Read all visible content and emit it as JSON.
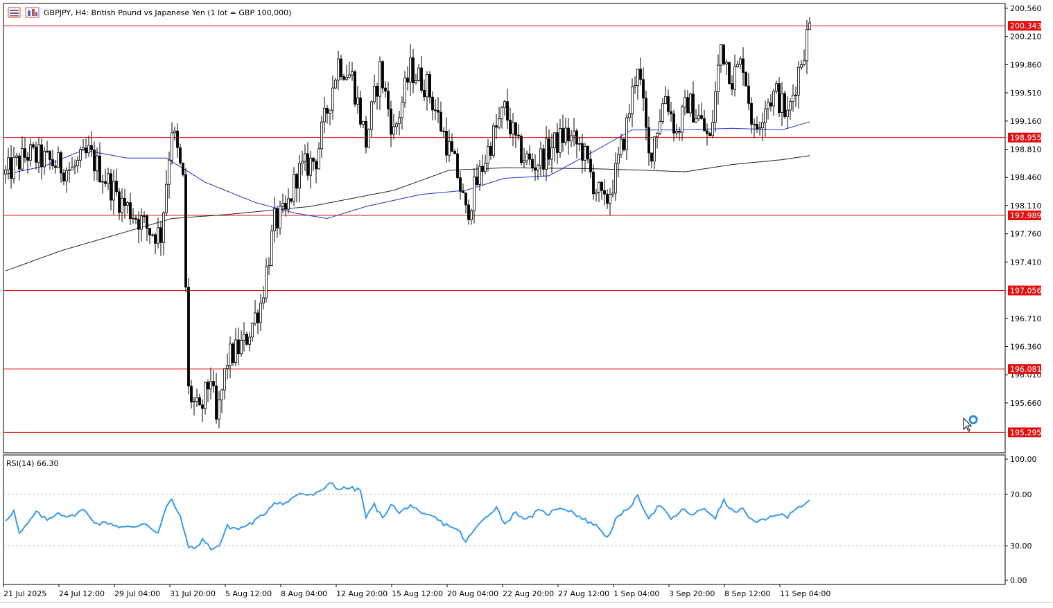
{
  "header": {
    "title": "GBPJPY, H4:  British Pound vs Japanese Yen (1 lot = GBP 100,000)"
  },
  "icons": {
    "menu": "chart-menu-icon",
    "ohlc": "chart-type-icon",
    "cursor": "arrow-cursor-icon",
    "loading": "loading-ring-icon"
  },
  "colors": {
    "candle": "#000000",
    "ma_fast": "#1f2fd6",
    "ma_slow": "#222222",
    "level_line": "#e01010",
    "rsi_line": "#3399ee",
    "axis": "#000000"
  },
  "chart_data": [
    {
      "type": "candlestick",
      "symbol": "GBPJPY",
      "timeframe": "H4",
      "ylim": [
        195.04,
        200.62
      ],
      "y_ticks": [
        "200.560",
        "200.210",
        "199.860",
        "199.510",
        "199.160",
        "198.810",
        "198.460",
        "198.110",
        "197.760",
        "197.410",
        "196.710",
        "196.360",
        "196.010",
        "195.660"
      ],
      "x_ticks": [
        "21 Jul 2025",
        "24 Jul 12:00",
        "29 Jul 04:00",
        "31 Jul 20:00",
        "5 Aug 12:00",
        "8 Aug 04:00",
        "12 Aug 20:00",
        "15 Aug 12:00",
        "20 Aug 04:00",
        "22 Aug 20:00",
        "27 Aug 12:00",
        "1 Sep 04:00",
        "3 Sep 20:00",
        "8 Sep 12:00",
        "11 Sep 04:00"
      ],
      "levels": [
        "200.343",
        "198.955",
        "197.989",
        "197.056",
        "196.081",
        "195.295"
      ],
      "anchors": [
        {
          "i": 0,
          "v": 198.5
        },
        {
          "i": 8,
          "v": 198.75
        },
        {
          "i": 16,
          "v": 198.65
        },
        {
          "i": 24,
          "v": 198.55
        },
        {
          "i": 30,
          "v": 198.75
        },
        {
          "i": 36,
          "v": 198.45
        },
        {
          "i": 42,
          "v": 198.15
        },
        {
          "i": 48,
          "v": 197.95
        },
        {
          "i": 52,
          "v": 197.8
        },
        {
          "i": 56,
          "v": 197.75
        },
        {
          "i": 60,
          "v": 199.1
        },
        {
          "i": 64,
          "v": 198.4
        },
        {
          "i": 66,
          "v": 195.8
        },
        {
          "i": 70,
          "v": 195.5
        },
        {
          "i": 74,
          "v": 196.0
        },
        {
          "i": 76,
          "v": 195.4
        },
        {
          "i": 80,
          "v": 196.2
        },
        {
          "i": 86,
          "v": 196.4
        },
        {
          "i": 92,
          "v": 196.9
        },
        {
          "i": 97,
          "v": 197.9
        },
        {
          "i": 101,
          "v": 198.0
        },
        {
          "i": 105,
          "v": 198.5
        },
        {
          "i": 112,
          "v": 198.7
        },
        {
          "i": 116,
          "v": 199.3
        },
        {
          "i": 120,
          "v": 199.9
        },
        {
          "i": 125,
          "v": 199.7
        },
        {
          "i": 130,
          "v": 198.9
        },
        {
          "i": 135,
          "v": 199.8
        },
        {
          "i": 140,
          "v": 199.0
        },
        {
          "i": 146,
          "v": 199.8
        },
        {
          "i": 152,
          "v": 199.6
        },
        {
          "i": 158,
          "v": 199.0
        },
        {
          "i": 163,
          "v": 198.5
        },
        {
          "i": 166,
          "v": 198.0
        },
        {
          "i": 170,
          "v": 198.4
        },
        {
          "i": 175,
          "v": 198.9
        },
        {
          "i": 180,
          "v": 199.3
        },
        {
          "i": 185,
          "v": 198.8
        },
        {
          "i": 190,
          "v": 198.6
        },
        {
          "i": 196,
          "v": 198.8
        },
        {
          "i": 202,
          "v": 199.0
        },
        {
          "i": 208,
          "v": 198.8
        },
        {
          "i": 212,
          "v": 198.4
        },
        {
          "i": 216,
          "v": 198.1
        },
        {
          "i": 220,
          "v": 198.5
        },
        {
          "i": 224,
          "v": 199.1
        },
        {
          "i": 228,
          "v": 199.9
        },
        {
          "i": 232,
          "v": 198.7
        },
        {
          "i": 238,
          "v": 199.5
        },
        {
          "i": 242,
          "v": 199.0
        },
        {
          "i": 246,
          "v": 199.4
        },
        {
          "i": 250,
          "v": 199.2
        },
        {
          "i": 254,
          "v": 198.9
        },
        {
          "i": 258,
          "v": 200.1
        },
        {
          "i": 262,
          "v": 199.7
        },
        {
          "i": 266,
          "v": 199.9
        },
        {
          "i": 270,
          "v": 199.0
        },
        {
          "i": 274,
          "v": 199.4
        },
        {
          "i": 278,
          "v": 199.5
        },
        {
          "i": 282,
          "v": 199.2
        },
        {
          "i": 286,
          "v": 199.8
        },
        {
          "i": 290,
          "v": 200.34
        }
      ],
      "series": [
        {
          "kind": "moving-average",
          "points": [
            {
              "i": 0,
              "v": 198.5
            },
            {
              "i": 14,
              "v": 198.6
            },
            {
              "i": 28,
              "v": 198.8
            },
            {
              "i": 44,
              "v": 198.7
            },
            {
              "i": 58,
              "v": 198.7
            },
            {
              "i": 72,
              "v": 198.4
            },
            {
              "i": 90,
              "v": 198.15
            },
            {
              "i": 104,
              "v": 198.02
            },
            {
              "i": 116,
              "v": 197.95
            },
            {
              "i": 130,
              "v": 198.1
            },
            {
              "i": 150,
              "v": 198.25
            },
            {
              "i": 166,
              "v": 198.3
            },
            {
              "i": 180,
              "v": 198.45
            },
            {
              "i": 196,
              "v": 198.48
            },
            {
              "i": 212,
              "v": 198.78
            },
            {
              "i": 226,
              "v": 199.05
            },
            {
              "i": 244,
              "v": 199.05
            },
            {
              "i": 262,
              "v": 199.07
            },
            {
              "i": 280,
              "v": 199.05
            },
            {
              "i": 290,
              "v": 199.15
            }
          ]
        },
        {
          "kind": "moving-average",
          "points": [
            {
              "i": 0,
              "v": 197.3
            },
            {
              "i": 20,
              "v": 197.55
            },
            {
              "i": 40,
              "v": 197.75
            },
            {
              "i": 60,
              "v": 197.95
            },
            {
              "i": 80,
              "v": 198.0
            },
            {
              "i": 110,
              "v": 198.1
            },
            {
              "i": 140,
              "v": 198.3
            },
            {
              "i": 160,
              "v": 198.55
            },
            {
              "i": 180,
              "v": 198.58
            },
            {
              "i": 210,
              "v": 198.57
            },
            {
              "i": 230,
              "v": 198.55
            },
            {
              "i": 245,
              "v": 198.53
            },
            {
              "i": 262,
              "v": 198.62
            },
            {
              "i": 280,
              "v": 198.68
            },
            {
              "i": 290,
              "v": 198.73
            }
          ]
        }
      ]
    },
    {
      "type": "line",
      "title": "RSI(14) 66.30",
      "ylim": [
        0,
        100
      ],
      "y_ticks": [
        "100.00",
        "70.00",
        "30.00",
        "0.00"
      ],
      "levels": [
        70,
        30
      ],
      "points": [
        {
          "i": 0,
          "v": 50
        },
        {
          "i": 3,
          "v": 57
        },
        {
          "i": 5,
          "v": 39
        },
        {
          "i": 8,
          "v": 47
        },
        {
          "i": 11,
          "v": 56
        },
        {
          "i": 15,
          "v": 50
        },
        {
          "i": 19,
          "v": 56
        },
        {
          "i": 23,
          "v": 52
        },
        {
          "i": 28,
          "v": 58
        },
        {
          "i": 33,
          "v": 47
        },
        {
          "i": 37,
          "v": 48
        },
        {
          "i": 41,
          "v": 45
        },
        {
          "i": 46,
          "v": 44
        },
        {
          "i": 50,
          "v": 48
        },
        {
          "i": 55,
          "v": 40
        },
        {
          "i": 58,
          "v": 60
        },
        {
          "i": 60,
          "v": 66
        },
        {
          "i": 63,
          "v": 52
        },
        {
          "i": 66,
          "v": 30
        },
        {
          "i": 68,
          "v": 27
        },
        {
          "i": 71,
          "v": 35
        },
        {
          "i": 74,
          "v": 28
        },
        {
          "i": 77,
          "v": 30
        },
        {
          "i": 80,
          "v": 45
        },
        {
          "i": 84,
          "v": 43
        },
        {
          "i": 89,
          "v": 48
        },
        {
          "i": 93,
          "v": 54
        },
        {
          "i": 97,
          "v": 64
        },
        {
          "i": 101,
          "v": 63
        },
        {
          "i": 106,
          "v": 71
        },
        {
          "i": 110,
          "v": 69
        },
        {
          "i": 114,
          "v": 72
        },
        {
          "i": 117,
          "v": 80
        },
        {
          "i": 120,
          "v": 74
        },
        {
          "i": 124,
          "v": 75
        },
        {
          "i": 128,
          "v": 73
        },
        {
          "i": 130,
          "v": 52
        },
        {
          "i": 133,
          "v": 62
        },
        {
          "i": 136,
          "v": 51
        },
        {
          "i": 139,
          "v": 63
        },
        {
          "i": 142,
          "v": 55
        },
        {
          "i": 146,
          "v": 62
        },
        {
          "i": 150,
          "v": 54
        },
        {
          "i": 154,
          "v": 53
        },
        {
          "i": 158,
          "v": 47
        },
        {
          "i": 161,
          "v": 45
        },
        {
          "i": 164,
          "v": 40
        },
        {
          "i": 166,
          "v": 33
        },
        {
          "i": 169,
          "v": 42
        },
        {
          "i": 173,
          "v": 52
        },
        {
          "i": 177,
          "v": 60
        },
        {
          "i": 180,
          "v": 47
        },
        {
          "i": 184,
          "v": 56
        },
        {
          "i": 188,
          "v": 50
        },
        {
          "i": 192,
          "v": 57
        },
        {
          "i": 196,
          "v": 55
        },
        {
          "i": 200,
          "v": 60
        },
        {
          "i": 204,
          "v": 57
        },
        {
          "i": 208,
          "v": 51
        },
        {
          "i": 212,
          "v": 47
        },
        {
          "i": 215,
          "v": 42
        },
        {
          "i": 217,
          "v": 36
        },
        {
          "i": 220,
          "v": 50
        },
        {
          "i": 224,
          "v": 58
        },
        {
          "i": 228,
          "v": 68
        },
        {
          "i": 232,
          "v": 52
        },
        {
          "i": 236,
          "v": 62
        },
        {
          "i": 240,
          "v": 50
        },
        {
          "i": 244,
          "v": 58
        },
        {
          "i": 248,
          "v": 54
        },
        {
          "i": 252,
          "v": 59
        },
        {
          "i": 256,
          "v": 52
        },
        {
          "i": 259,
          "v": 65
        },
        {
          "i": 262,
          "v": 57
        },
        {
          "i": 266,
          "v": 58
        },
        {
          "i": 270,
          "v": 48
        },
        {
          "i": 274,
          "v": 50
        },
        {
          "i": 278,
          "v": 55
        },
        {
          "i": 282,
          "v": 52
        },
        {
          "i": 285,
          "v": 60
        },
        {
          "i": 288,
          "v": 62
        },
        {
          "i": 290,
          "v": 66.3
        }
      ]
    }
  ]
}
